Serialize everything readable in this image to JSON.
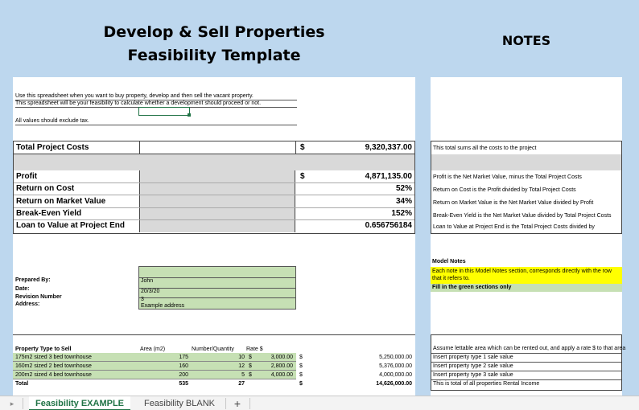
{
  "header": {
    "title_line1": "Develop & Sell Properties",
    "title_line2": "Feasibility Template",
    "notes_title": "NOTES"
  },
  "intro": {
    "line1": "Use this spreadsheet when you want to buy property, develop and then sell the vacant property.",
    "line2": "This spreadsheet will be your feasibility to calculate whether a development should proceed or not.",
    "line3": "All values should exclude tax."
  },
  "summary": {
    "total_label": "Total Project Costs",
    "total_currency": "$",
    "total_value": "9,320,337.00",
    "rows": [
      {
        "label": "Profit",
        "currency": "$",
        "value": "4,871,135.00"
      },
      {
        "label": "Return on Cost",
        "currency": "",
        "value": "52%"
      },
      {
        "label": "Return on Market Value",
        "currency": "",
        "value": "34%"
      },
      {
        "label": "Break-Even Yield",
        "currency": "",
        "value": "152%"
      },
      {
        "label": "Loan to Value at Project End",
        "currency": "",
        "value": "0.656756184"
      }
    ]
  },
  "notes": {
    "total": "This total sums all the costs to the project",
    "rows": [
      "Profit is the Net Market Value, minus the Total Project Costs",
      "Return on Cost is the Profit divided by Total Project Costs",
      "Return on Market Value is the Net Market Value divided by Profit",
      "Break-Even Yield is the Net Market Value divided by Total Project Costs",
      "Loan to Value at Project End is the Total Project Costs divided by"
    ],
    "model_notes_title": "Model Notes",
    "model_note_yellow_1": "Each note in this Model Notes section, corresponds directly with the row",
    "model_note_yellow_2": "that it refers to.",
    "model_note_green": "Fill in the green sections only",
    "property_notes": [
      "Assume lettable area which can be rented out, and apply a rate $ to that area",
      "Insert property type 1 sale value",
      "Insert property type 2 sale value",
      "Insert property type 3 sale value",
      "This is total of all properties Rental Income"
    ]
  },
  "prepared": {
    "rows": [
      {
        "label": "Prepared By:",
        "value": "John"
      },
      {
        "label": "Date:",
        "value": "20/3/20"
      },
      {
        "label": "Revision Number",
        "value": "3"
      },
      {
        "label": "Address:",
        "value": "Example address"
      }
    ]
  },
  "property_table": {
    "headers": {
      "type": "Property Type to Sell",
      "area": "Area (m2)",
      "qty": "Number/Quantity",
      "rate": "Rate $"
    },
    "rows": [
      {
        "type": "175m2 sized 3 bed townhouse",
        "area": "175",
        "qty": "10",
        "rate_cur": "$",
        "rate": "3,000.00",
        "total_cur": "$",
        "total": "5,250,000.00"
      },
      {
        "type": "160m2 sized 2 bed townhouse",
        "area": "160",
        "qty": "12",
        "rate_cur": "$",
        "rate": "2,800.00",
        "total_cur": "$",
        "total": "5,376,000.00"
      },
      {
        "type": "200m2 sized 4 bed townhouse",
        "area": "200",
        "qty": "5",
        "rate_cur": "$",
        "rate": "4,000.00",
        "total_cur": "$",
        "total": "4,000,000.00"
      }
    ],
    "total_row": {
      "label": "Total",
      "area": "535",
      "qty": "27",
      "total_cur": "$",
      "total": "14,626,000.00"
    }
  },
  "tabs": {
    "items": [
      "Feasibility EXAMPLE",
      "Feasibility BLANK"
    ],
    "add": "+",
    "nav": "▸"
  },
  "colors": {
    "green_fill": "#c6e0b4",
    "yellow_fill": "#ffff00",
    "sheet_bg": "#bdd7ee",
    "active_tab": "#217346"
  }
}
